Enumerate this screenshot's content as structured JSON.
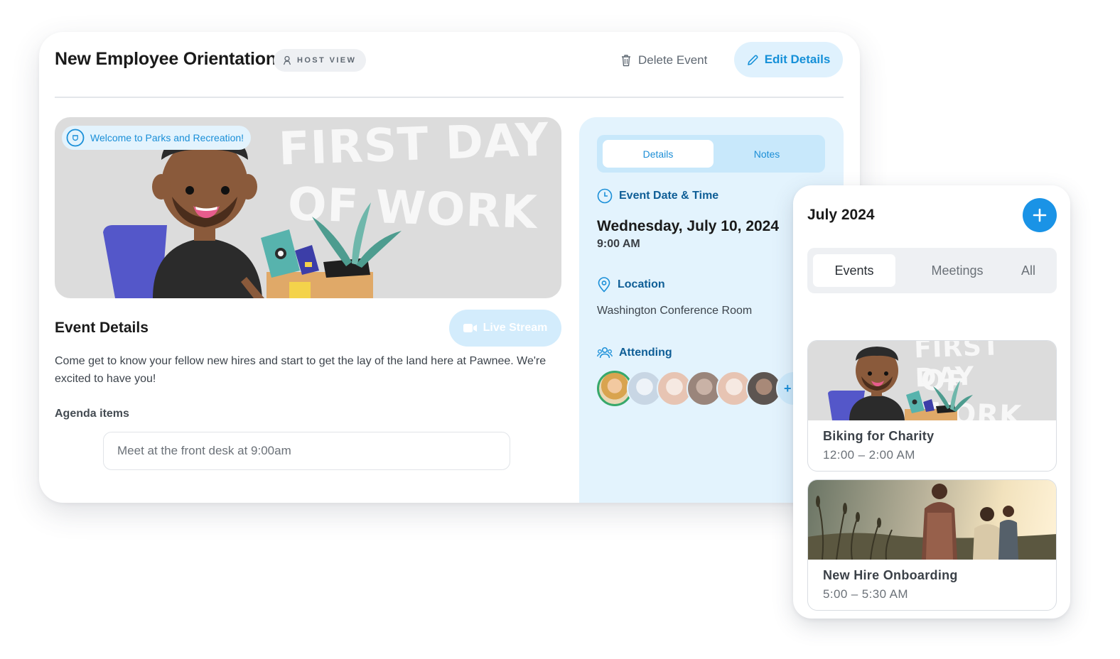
{
  "event": {
    "title": "New Employee Orientation",
    "host_badge": "HOST VIEW",
    "delete_label": "Delete Event",
    "edit_label": "Edit Details",
    "hero": {
      "welcome": "Welcome to Parks and Recreation!",
      "headline_line1": "FIRST DAY",
      "headline_line2": "OF WORK"
    },
    "details_heading": "Event Details",
    "live_stream_label": "Live Stream",
    "description": "Come get to know your fellow new hires and start to get the lay of the land here at Pawnee. We're excited to have you!",
    "agenda_label": "Agenda items",
    "agenda_items": [
      "Meet at the front desk at 9:00am"
    ]
  },
  "panel": {
    "tabs": [
      {
        "label": "Details",
        "active": true
      },
      {
        "label": "Notes",
        "active": false
      }
    ],
    "date_time_heading": "Event Date & Time",
    "date": "Wednesday, July 10, 2024",
    "time": "9:00 AM",
    "location_heading": "Location",
    "location": "Washington Conference Room",
    "attending_heading": "Attending",
    "attendee_more": "+"
  },
  "calendar": {
    "month": "July 2024",
    "add_icon": "plus-icon",
    "segments": [
      {
        "label": "Events",
        "active": true
      },
      {
        "label": "Meetings",
        "active": false
      },
      {
        "label": "All",
        "active": false
      }
    ],
    "events": [
      {
        "name": "Biking for Charity",
        "time": "12:00 – 2:00 AM",
        "image_text_1": "FIRST DAY",
        "image_text_2": "OF WORK"
      },
      {
        "name": "New Hire Onboarding",
        "time": "5:00 – 5:30 AM"
      }
    ]
  },
  "colors": {
    "accent": "#1a93e6",
    "accent_light": "#dff1fd",
    "panel_bg": "#e3f3fd",
    "heading_blue": "#0f5e96"
  }
}
